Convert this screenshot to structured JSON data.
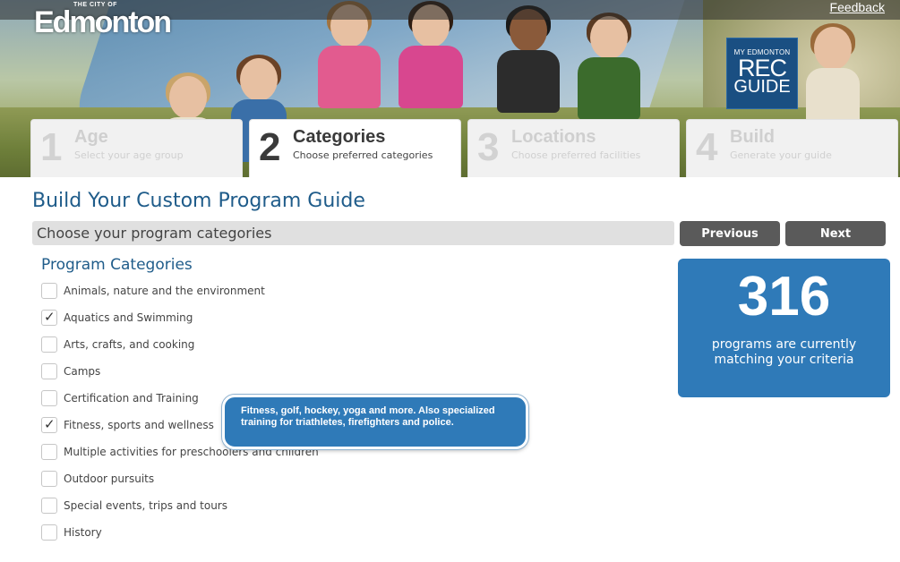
{
  "header": {
    "logo_small": "THE CITY OF",
    "logo_name": "Edmonton",
    "feedback_label": "Feedback",
    "badge": {
      "line1": "MY EDMONTON",
      "line2": "REC",
      "line3": "GUIDE"
    }
  },
  "steps": [
    {
      "number": "1",
      "title": "Age",
      "subtitle": "Select your age group",
      "active": false
    },
    {
      "number": "2",
      "title": "Categories",
      "subtitle": "Choose preferred categories",
      "active": true
    },
    {
      "number": "3",
      "title": "Locations",
      "subtitle": "Choose preferred facilities",
      "active": false
    },
    {
      "number": "4",
      "title": "Build",
      "subtitle": "Generate your guide",
      "active": false
    }
  ],
  "main": {
    "page_title": "Build Your Custom Program Guide",
    "subheading": "Choose your program categories",
    "previous_label": "Previous",
    "next_label": "Next",
    "section_title": "Program Categories",
    "categories": [
      {
        "label": "Animals, nature and the environment",
        "checked": false
      },
      {
        "label": "Aquatics and Swimming",
        "checked": true
      },
      {
        "label": "Arts, crafts, and cooking",
        "checked": false
      },
      {
        "label": "Camps",
        "checked": false
      },
      {
        "label": "Certification and Training",
        "checked": false
      },
      {
        "label": "Fitness, sports and wellness",
        "checked": true
      },
      {
        "label": "Multiple activities for preschoolers and children",
        "checked": false
      },
      {
        "label": "Outdoor pursuits",
        "checked": false
      },
      {
        "label": "Special events, trips and tours",
        "checked": false
      },
      {
        "label": "History",
        "checked": false
      }
    ],
    "tooltip": "Fitness, golf, hockey, yoga and more. Also specialized training for triathletes, firefighters and police."
  },
  "counter": {
    "count": "316",
    "text": "programs are currently matching your criteria"
  },
  "colors": {
    "brand_blue": "#2f7ab8",
    "title_blue": "#1f5c8a",
    "button_gray": "#5a5a5a",
    "badge_navy": "#1a4f82"
  }
}
